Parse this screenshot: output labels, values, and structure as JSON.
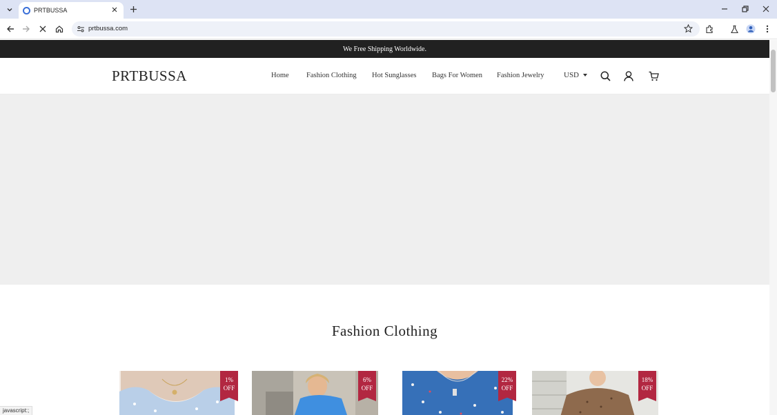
{
  "browser": {
    "tab_title": "PRTBUSSA",
    "url": "prtbussa.com",
    "status_text": "javascript:;"
  },
  "announcement": "We Free Shipping Worldwide.",
  "header": {
    "logo": "PRTBUSSA",
    "nav": [
      "Home",
      "Fashion Clothing",
      "Hot Sunglasses",
      "Bags For Women",
      "Fashion Jewelry"
    ],
    "currency": "USD"
  },
  "section": {
    "title": "Fashion Clothing"
  },
  "products": [
    {
      "badge_pct": "1%",
      "badge_off": "OFF"
    },
    {
      "badge_pct": "6%",
      "badge_off": "OFF"
    },
    {
      "badge_pct": "22%",
      "badge_off": "OFF"
    },
    {
      "badge_pct": "18%",
      "badge_off": "OFF"
    }
  ],
  "colors": {
    "announce_bg": "#212121",
    "badge": "#b22741",
    "hero_bg": "#efefef",
    "tab_strip": "#dde3f4"
  }
}
